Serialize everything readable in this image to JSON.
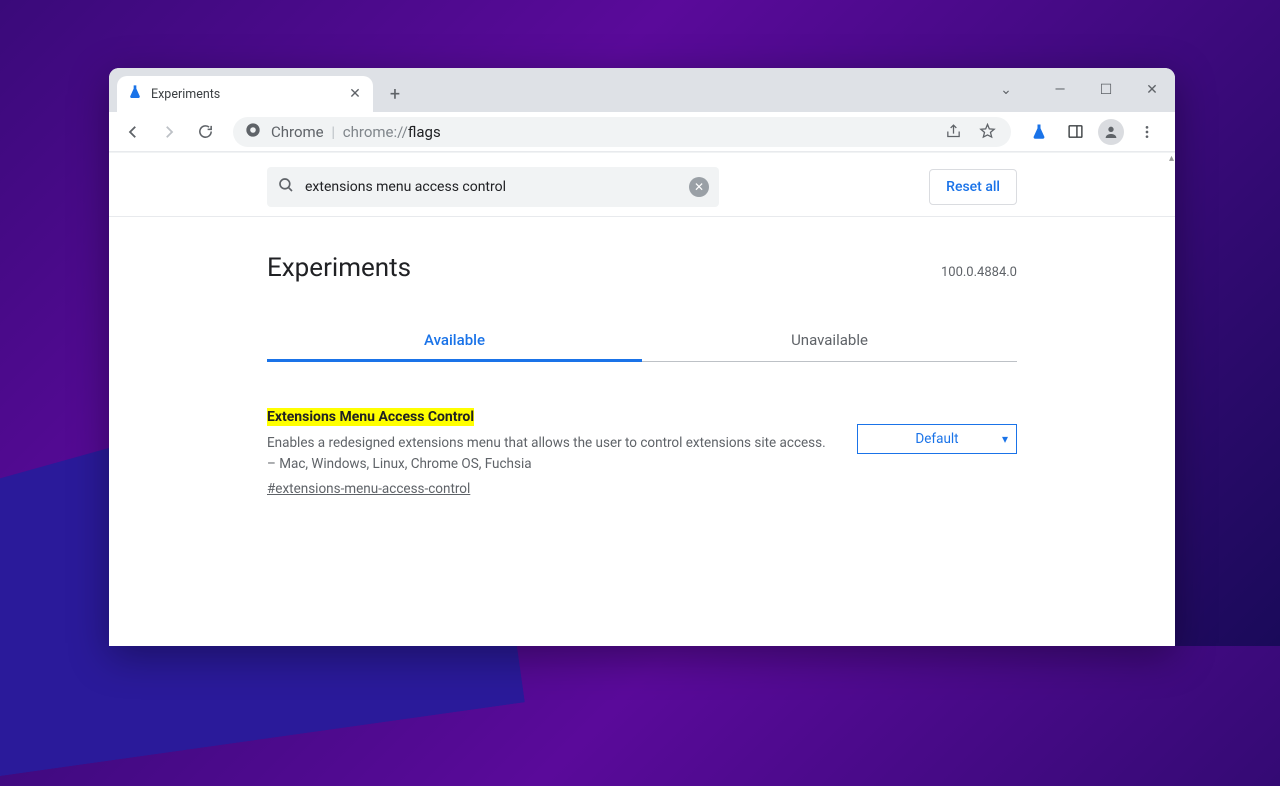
{
  "window": {
    "tab": {
      "title": "Experiments"
    },
    "url": {
      "host": "Chrome",
      "scheme": "chrome://",
      "path": "flags"
    }
  },
  "flags": {
    "search": {
      "value": "extensions menu access control"
    },
    "reset_label": "Reset all",
    "title": "Experiments",
    "version": "100.0.4884.0",
    "tabs": {
      "available": "Available",
      "unavailable": "Unavailable"
    },
    "item": {
      "title": "Extensions Menu Access Control",
      "desc": "Enables a redesigned extensions menu that allows the user to control extensions site access. – Mac, Windows, Linux, Chrome OS, Fuchsia",
      "id": "#extensions-menu-access-control",
      "select": "Default"
    }
  }
}
